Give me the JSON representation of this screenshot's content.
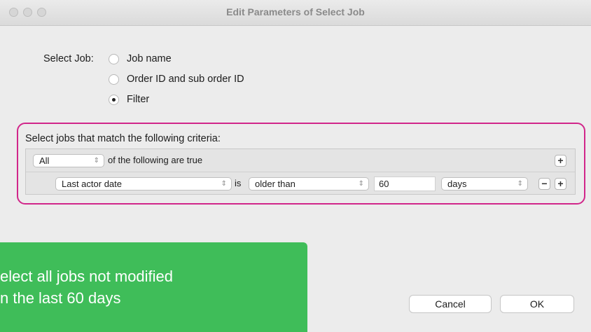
{
  "window": {
    "title": "Edit Parameters of Select Job"
  },
  "select_job": {
    "label": "Select Job:",
    "options": [
      {
        "label": "Job name",
        "selected": false
      },
      {
        "label": "Order ID and sub order ID",
        "selected": false
      },
      {
        "label": "Filter",
        "selected": true
      }
    ]
  },
  "criteria": {
    "heading": "Select jobs that match the following criteria:",
    "match_mode": "All",
    "match_suffix": "of the following are true",
    "rule": {
      "field": "Last actor date",
      "operator_label": "is",
      "comparison": "older than",
      "value": "60",
      "unit": "days"
    },
    "add_symbol": "+",
    "remove_symbol": "−"
  },
  "buttons": {
    "cancel": "Cancel",
    "ok": "OK"
  },
  "callout": {
    "text": "elect all jobs not modified\nn the last 60 days"
  },
  "colors": {
    "highlight": "#d1268a",
    "callout": "#3fbd59"
  },
  "icons": {
    "stepper": "updown-chevron-icon",
    "add": "plus-icon",
    "remove": "minus-icon",
    "window_controls": "traffic-light-icon"
  }
}
